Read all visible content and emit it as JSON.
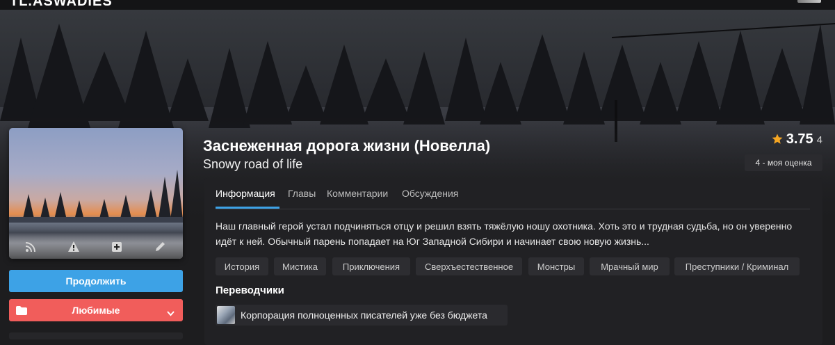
{
  "header": {
    "logo_text": "TL.ASWADIES",
    "user_avatar_icon": "user-avatar"
  },
  "book": {
    "title": "Заснеженная дорога жизни (Новелла)",
    "original_title": "Snowy road of life",
    "rating": "3.75",
    "rating_count": "4",
    "my_rating": "4 - моя оценка"
  },
  "cover_actions": [
    {
      "icon": "rss-icon"
    },
    {
      "icon": "report-icon"
    },
    {
      "icon": "add-icon"
    },
    {
      "icon": "edit-icon"
    }
  ],
  "buttons": {
    "continue": "Продолжить",
    "favorites": "Любимые"
  },
  "tabs": [
    {
      "label": "Информация",
      "active": true
    },
    {
      "label": "Главы",
      "active": false
    },
    {
      "label": "Комментарии",
      "active": false
    },
    {
      "label": "Обсуждения",
      "active": false
    }
  ],
  "description": "Наш главный герой устал подчиняться отцу и решил взять тяжёлую ношу охотника. Хоть это и трудная судьба, но он уверенно идёт к ней. Обычный парень попадает на Юг Западной Сибири и начинает свою новую жизнь...",
  "tags": [
    "История",
    "Мистика",
    "Приключения",
    "Сверхъестественное",
    "Монстры",
    "Мрачный мир",
    "Преступники / Криминал"
  ],
  "translators_heading": "Переводчики",
  "translators": [
    {
      "name": "Корпорация полноценных писателей уже без бюджета"
    }
  ],
  "colors": {
    "accent": "#3da2e6",
    "favorite": "#f15d5b",
    "background": "#1d1d1f",
    "star": "#f5a623"
  }
}
